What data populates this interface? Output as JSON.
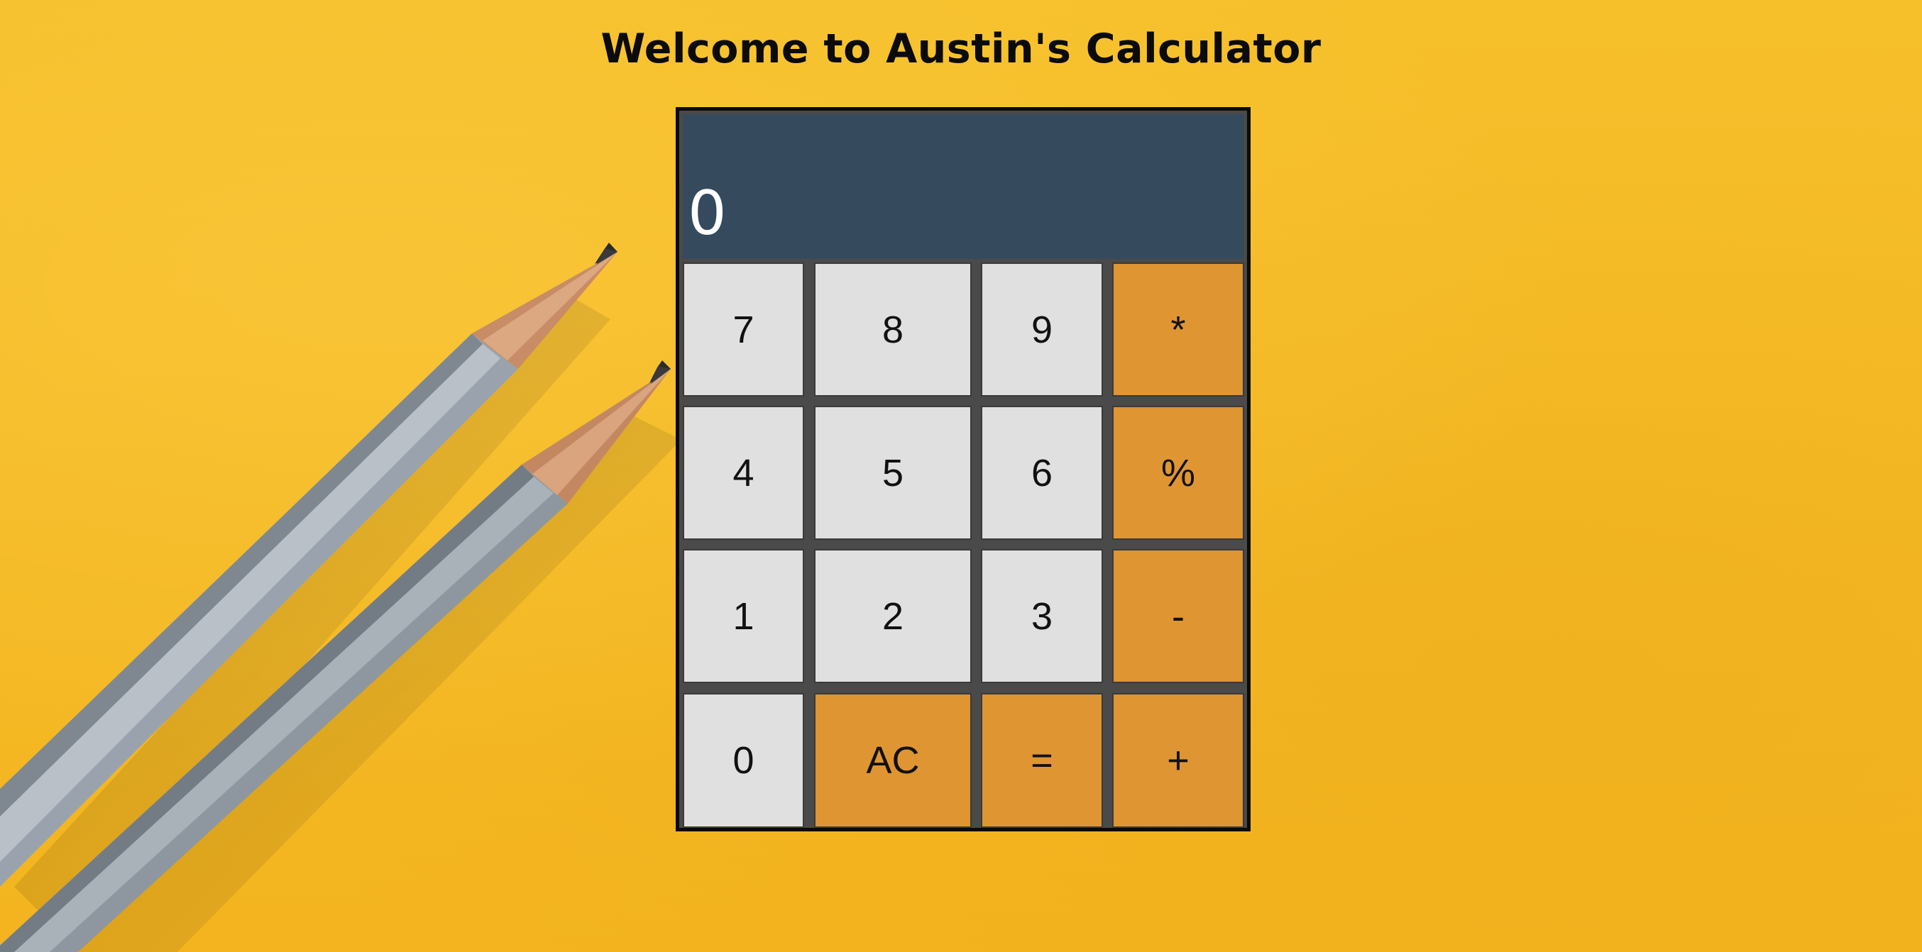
{
  "page": {
    "title": "Welcome to Austin's Calculator",
    "background_color": "#f4bb25"
  },
  "calculator": {
    "display_value": "0",
    "display_color": "#364a5e",
    "number_key_color": "#e0e0e0",
    "operator_key_color": "#df9532",
    "keys": {
      "seven": "7",
      "eight": "8",
      "nine": "9",
      "multiply": "*",
      "four": "4",
      "five": "5",
      "six": "6",
      "percent": "%",
      "one": "1",
      "two": "2",
      "three": "3",
      "minus": "-",
      "zero": "0",
      "clear": "AC",
      "equals": "=",
      "plus": "+"
    }
  },
  "decorations": {
    "background_image": "pencils-photo"
  }
}
